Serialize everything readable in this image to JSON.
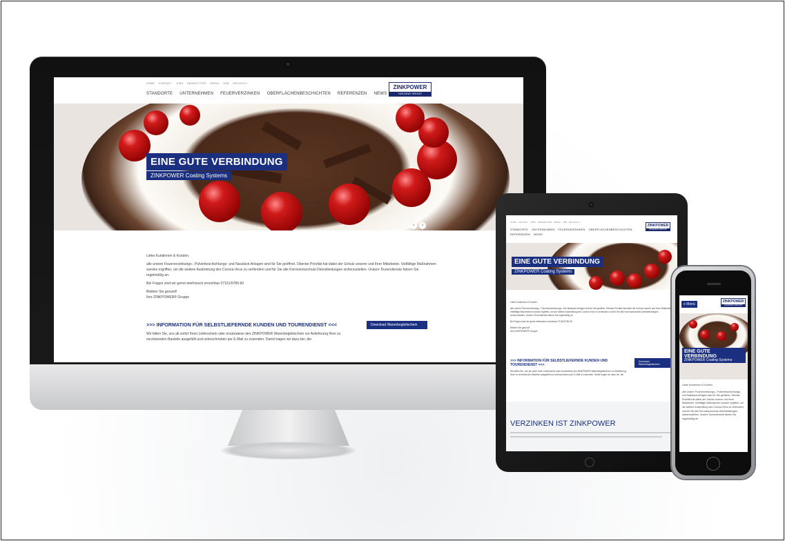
{
  "desktop": {
    "topnav": [
      "HOME",
      "KONTAKT",
      "JOBS",
      "NEWSLETTER",
      "MEDIA",
      "AGB",
      "DEUTSCH ~"
    ],
    "mainnav": [
      "STANDORTE",
      "UNTERNEHMEN",
      "FEUERVERZINKEN",
      "OBERFLÄCHENBESCHICHTEN",
      "REFERENZEN",
      "NEWS"
    ],
    "logo": {
      "main": "ZINKPOWER",
      "sub": "HOLDING GROUP"
    },
    "hero": {
      "title": "EINE GUTE VERBINDUNG",
      "subtitle": "ZINKPOWER Coating Systems"
    },
    "content": {
      "greeting": "Liebe Kundinnen & Kunden,",
      "p1": "alle unsere Feuerverzinkungs-, Pulverbeschichtungs- und Nasslack-Anlagen sind für Sie geöffnet. Oberste Priorität hat dabei der Schutz unserer und Ihrer Mitarbeiter. Vielfältige Maßnahmen wurden ergriffen, um die weitere Ausbreitung des Corona-Virus zu verhindern und für Sie alle Korrosionsschutz-Dienstleistungen sicherzustellen. Unsere Tourendienste fahren Sie regelmäßig an.",
      "p2": "Bei Fragen sind wir gerne telefonisch erreichbar 07151/9780-60",
      "p3": "Bleiben Sie gesund!",
      "p4": "Ihre ZINKPOWER® Gruppe",
      "info_heading": ">>> INFORMATION FÜR SELBSTLIEFERNDE KUNDEN UND TOURENDIENST <<<",
      "info_text": "Wir bitten Sie, uns ab sofort Ihren Lieferschein oder ersatzweise den ZINKPOWER Warenbegleitschein vor Anlieferung Ihrer zu verzinkenden Bauteile ausgefüllt und unterschrieben per E-Mail zu zusenden. Damit tragen wir dazu bei, die",
      "download": "Download Warenbegleitschein"
    }
  },
  "tablet": {
    "heading": "VERZINKEN IST ZINKPOWER"
  },
  "phone": {
    "menu": "≡ Menü"
  }
}
